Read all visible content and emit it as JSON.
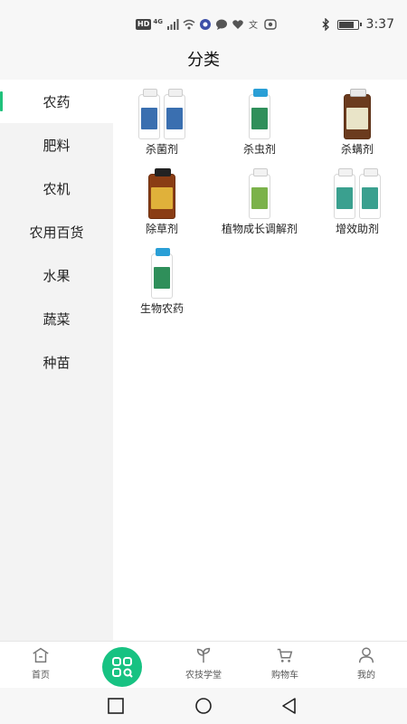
{
  "status_bar": {
    "network_badge": "HD",
    "network_type": "4G",
    "time": "3:37",
    "battery_level": 0.85,
    "icons": [
      "signal-icon",
      "wifi-icon",
      "app-notification-icon",
      "message-icon",
      "health-icon",
      "translate-icon",
      "app-icon",
      "bluetooth-icon",
      "battery-icon"
    ]
  },
  "header": {
    "title": "分类"
  },
  "sidebar": {
    "active_index": 0,
    "accent_color": "#1fc17b",
    "items": [
      {
        "label": "农药"
      },
      {
        "label": "肥料"
      },
      {
        "label": "农机"
      },
      {
        "label": "农用百货"
      },
      {
        "label": "水果"
      },
      {
        "label": "蔬菜"
      },
      {
        "label": "种苗"
      }
    ]
  },
  "grid": {
    "items": [
      {
        "label": "杀菌剂"
      },
      {
        "label": "杀虫剂"
      },
      {
        "label": "杀螨剂"
      },
      {
        "label": "除草剂"
      },
      {
        "label": "植物成长调解剂"
      },
      {
        "label": "增效助剂"
      },
      {
        "label": "生物农药"
      }
    ]
  },
  "bottom_nav": {
    "brand_color": "#17c282",
    "items": [
      {
        "label": "首页",
        "icon": "home-icon"
      },
      {
        "label": "",
        "icon": "category-grid-icon"
      },
      {
        "label": "农技学堂",
        "icon": "sprout-icon"
      },
      {
        "label": "购物车",
        "icon": "cart-icon"
      },
      {
        "label": "我的",
        "icon": "user-icon"
      }
    ]
  },
  "system_nav": {
    "icons": [
      "recent-apps-icon",
      "home-circle-icon",
      "back-triangle-icon"
    ]
  }
}
